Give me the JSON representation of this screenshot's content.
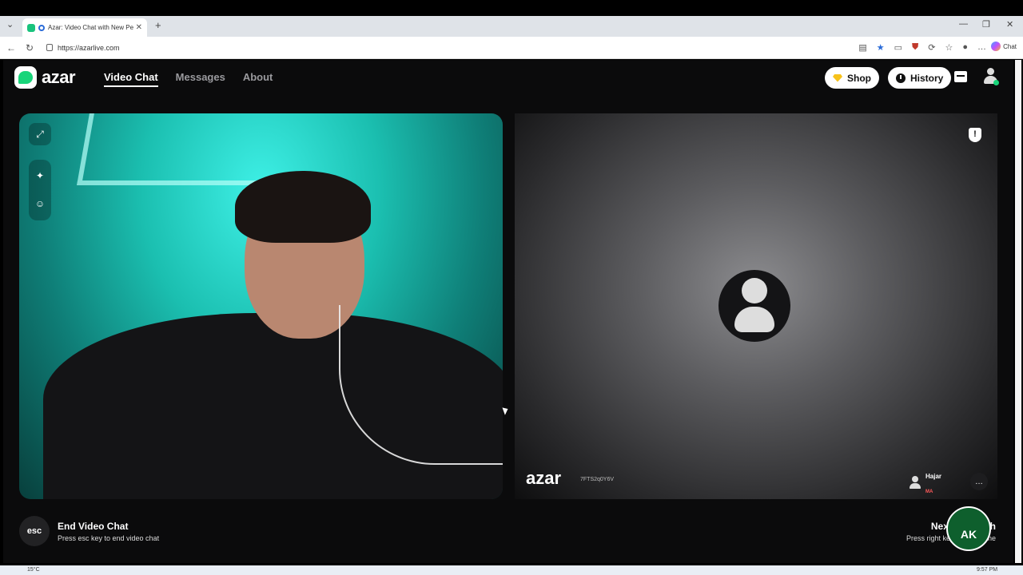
{
  "browser": {
    "tab_title": "Azar: Video Chat with New Pe",
    "url": "https://azarlive.com",
    "chat_label": "Chat"
  },
  "site": {
    "brand": "azar",
    "nav": [
      "Video Chat",
      "Messages",
      "About"
    ],
    "active_nav": "Video Chat",
    "shop_label": "Shop",
    "history_label": "History"
  },
  "remote": {
    "watermark": "azar",
    "session_id": "7FTS2q0Y6V",
    "peer_name": "Hajar",
    "peer_country": "MA"
  },
  "footer": {
    "esc_key": "esc",
    "end_title": "End Video Chat",
    "end_sub": "Press esc key to end video chat",
    "next_title": "Next Video Ch",
    "next_sub": "Press right key to meet othe",
    "badge_text": "AK"
  },
  "taskbar": {
    "weather": "15°C",
    "time": "9:57 PM"
  },
  "colors": {
    "accent": "#19d57a",
    "page_bg": "#0b0b0c",
    "gem": "#f7c21a"
  }
}
